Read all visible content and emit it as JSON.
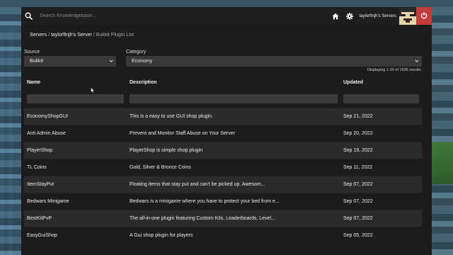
{
  "header": {
    "search_placeholder": "Search Knowledgebase...",
    "username": "taylorftnjh's Servers"
  },
  "breadcrumb": {
    "item1": "Servers",
    "item2": "taylorftnjh's Server",
    "current": "Bukkit Plugin List"
  },
  "filters": {
    "source_label": "Source",
    "source_value": "Bukkit",
    "category_label": "Category",
    "category_value": "Economy"
  },
  "results_text": "Displaying 1-20 of 1636 results.",
  "table": {
    "columns": [
      "Name",
      "Description",
      "Updated"
    ],
    "rows": [
      {
        "name": "EconomyShopGUI",
        "description": "This is a easy to use GUI shop plugin.",
        "updated": "Sep 21, 2022"
      },
      {
        "name": "Anti Admin Abuse",
        "description": "Prevent and Monitor Staff Abuse on Your Server",
        "updated": "Sep 20, 2022"
      },
      {
        "name": "PlayerShop",
        "description": "PlayerShop is simple shop plugin",
        "updated": "Sep 19, 2022"
      },
      {
        "name": "TL Coins",
        "description": "Gold, Silver & Bronce Coins",
        "updated": "Sep 11, 2022"
      },
      {
        "name": "ItemStayPut",
        "description": "Floating items that stay put and can't be picked up. Awesom...",
        "updated": "Sep 07, 2022"
      },
      {
        "name": "Bedwars Minigame",
        "description": "Bedwars is a minigame where you have to protect your bed from e...",
        "updated": "Sep 07, 2022"
      },
      {
        "name": "BestKitPvP",
        "description": "The all-in-one plugin featuring Custom Kits, Leaderboards, Level...",
        "updated": "Sep 07, 2022"
      },
      {
        "name": "EasyGuiShop",
        "description": "A Gui shop plugin for players",
        "updated": "Sep 05, 2022"
      }
    ]
  },
  "icons": {
    "search": "search-icon",
    "home": "home-icon",
    "settings": "gear-icon",
    "power": "power-icon"
  },
  "colors": {
    "power_button": "#c43b3b",
    "panel": "#1c1c1c",
    "topbar": "#1e1e1e"
  }
}
